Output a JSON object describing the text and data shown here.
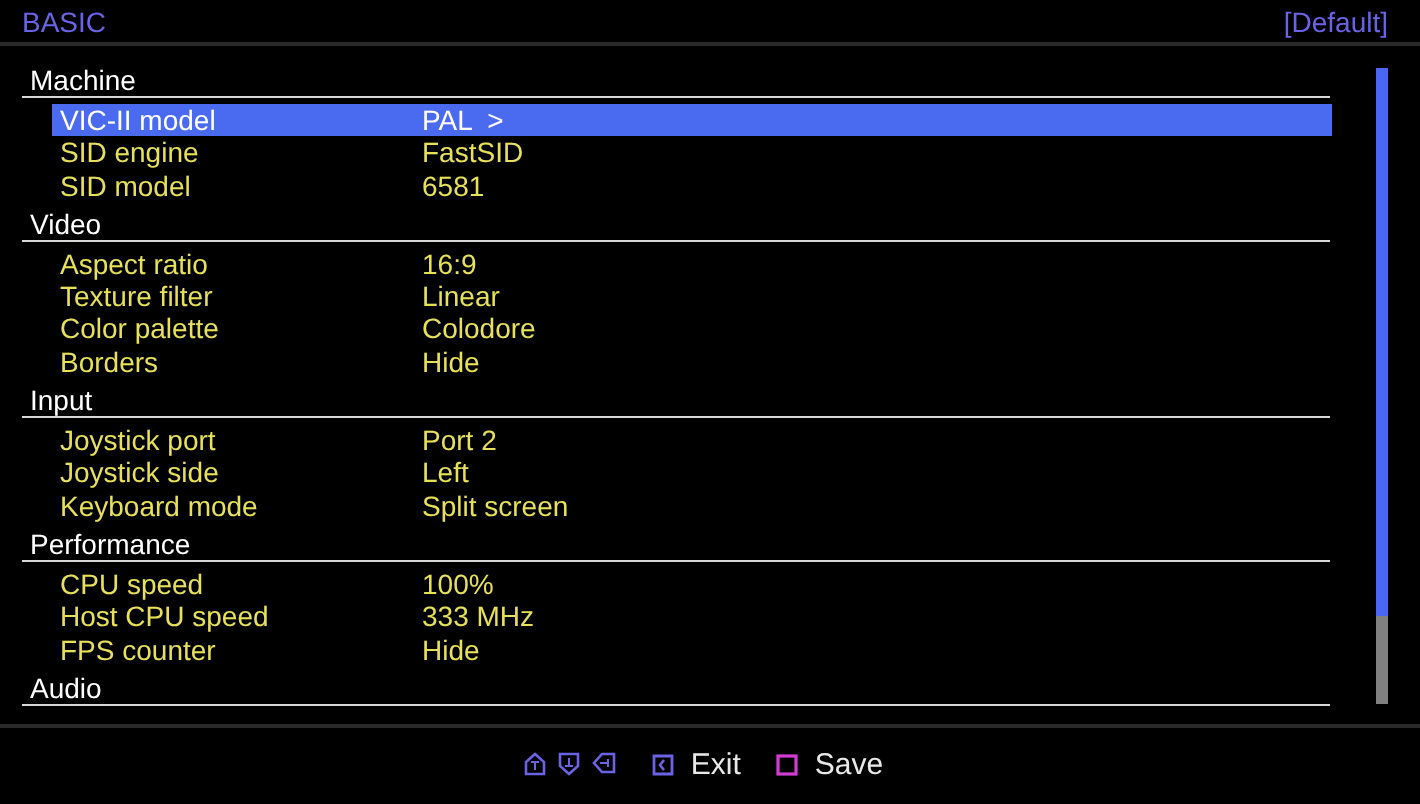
{
  "header": {
    "title": "BASIC",
    "preset": "[Default]"
  },
  "sections": [
    {
      "title": "Machine",
      "items": [
        {
          "label": "VIC-II model",
          "value": "PAL  >",
          "selected": true
        },
        {
          "label": "SID engine",
          "value": "FastSID",
          "selected": false
        },
        {
          "label": "SID model",
          "value": "6581",
          "selected": false
        }
      ]
    },
    {
      "title": "Video",
      "items": [
        {
          "label": "Aspect ratio",
          "value": "16:9",
          "selected": false
        },
        {
          "label": "Texture filter",
          "value": "Linear",
          "selected": false
        },
        {
          "label": "Color palette",
          "value": "Colodore",
          "selected": false
        },
        {
          "label": "Borders",
          "value": "Hide",
          "selected": false
        }
      ]
    },
    {
      "title": "Input",
      "items": [
        {
          "label": "Joystick port",
          "value": "Port 2",
          "selected": false
        },
        {
          "label": "Joystick side",
          "value": "Left",
          "selected": false
        },
        {
          "label": "Keyboard mode",
          "value": "Split screen",
          "selected": false
        }
      ]
    },
    {
      "title": "Performance",
      "items": [
        {
          "label": "CPU speed",
          "value": "100%",
          "selected": false
        },
        {
          "label": "Host CPU speed",
          "value": "333 MHz",
          "selected": false
        },
        {
          "label": "FPS counter",
          "value": "Hide",
          "selected": false
        }
      ]
    },
    {
      "title": "Audio"
    }
  ],
  "footer": [
    {
      "kind": "nav"
    },
    {
      "kind": "exit",
      "label": "Exit"
    },
    {
      "kind": "save",
      "label": "Save"
    }
  ]
}
